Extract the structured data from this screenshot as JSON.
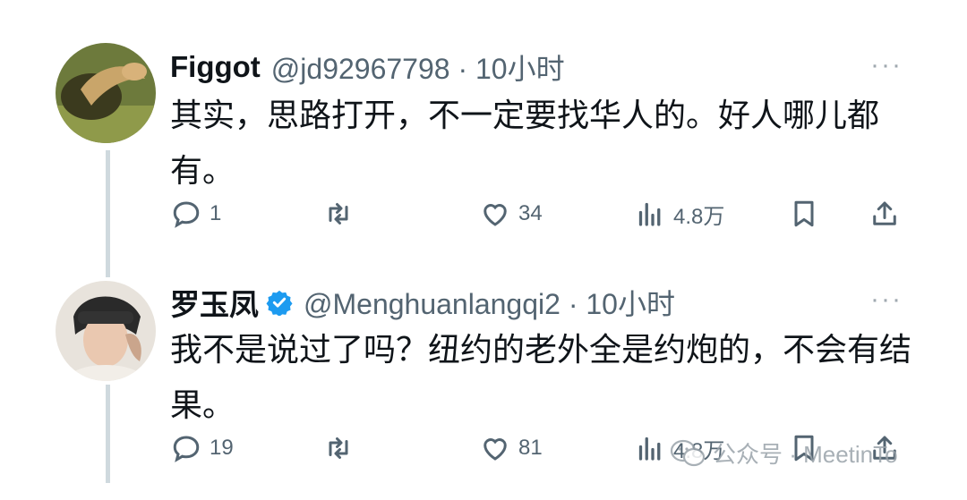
{
  "tweets": [
    {
      "name": "Figgot",
      "handle": "@jd92967798 · 10小时",
      "text": "其实，思路打开，不一定要找华人的。好人哪儿都有。",
      "more": "···",
      "reply_count": "1",
      "like_count": "34",
      "view_count": "4.8万"
    },
    {
      "name": "罗玉凤",
      "handle": "@Menghuanlangqi2 · 10小时",
      "text": "我不是说过了吗？纽约的老外全是约炮的，不会有结果。",
      "more": "···",
      "reply_count": "19",
      "like_count": "81",
      "view_count": "4.8万"
    }
  ],
  "watermark": {
    "text": "公众号 · MeetinTo"
  },
  "colors": {
    "verified": "#1d9bf0",
    "muted": "#536471",
    "thread": "#cfd9de"
  }
}
